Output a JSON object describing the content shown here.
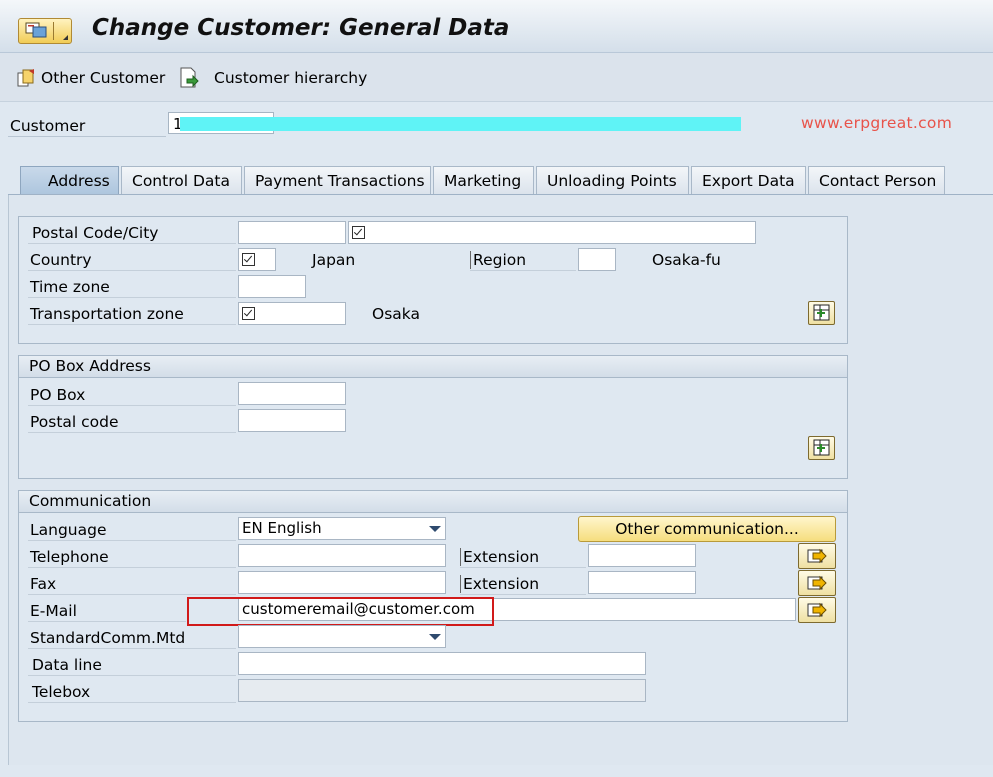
{
  "window": {
    "title": "Change Customer: General Data"
  },
  "toolbar": {
    "other_customer": "Other Customer",
    "customer_hierarchy": "Customer hierarchy"
  },
  "customer": {
    "label": "Customer",
    "value": "1"
  },
  "watermark": "www.erpgreat.com",
  "tabs": [
    {
      "label": "Address",
      "active": true
    },
    {
      "label": "Control Data"
    },
    {
      "label": "Payment Transactions"
    },
    {
      "label": "Marketing"
    },
    {
      "label": "Unloading Points"
    },
    {
      "label": "Export Data"
    },
    {
      "label": "Contact Person"
    }
  ],
  "address": {
    "postal_city_label": "Postal Code/City",
    "country_label": "Country",
    "country_name": "Japan",
    "region_label": "Region",
    "region_name": "Osaka-fu",
    "timezone_label": "Time zone",
    "transport_label": "Transportation zone",
    "transport_name": "Osaka"
  },
  "pobox": {
    "title": "PO Box Address",
    "pobox_label": "PO Box",
    "postal_label": "Postal code"
  },
  "communication": {
    "title": "Communication",
    "language_label": "Language",
    "language_value": "EN English",
    "other_comm_label": "Other communication...",
    "telephone_label": "Telephone",
    "extension_label": "Extension",
    "fax_label": "Fax",
    "fax_extension_label": "Extension",
    "email_label": "E-Mail",
    "email_value": "customeremail@customer.com",
    "std_comm_label": "StandardComm.Mtd",
    "dataline_label": "Data line",
    "telebox_label": "Telebox"
  },
  "colors": {
    "highlight": "#d11a1a",
    "watermark": "#e8534a",
    "mask": "#5ff3f6"
  }
}
